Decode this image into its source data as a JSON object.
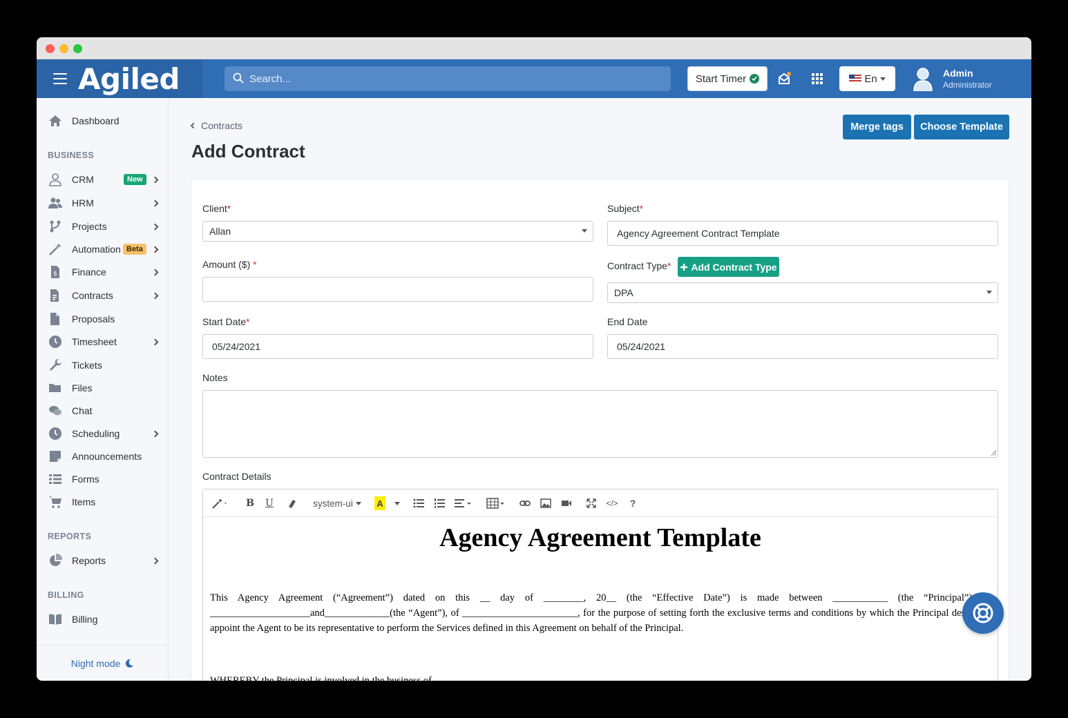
{
  "app": {
    "brand": "Agiled"
  },
  "search": {
    "placeholder": "Search..."
  },
  "topbar": {
    "start_timer_label": "Start Timer",
    "language": "En",
    "user_name": "Admin",
    "user_role": "Administrator"
  },
  "sidebar": {
    "dashboard": "Dashboard",
    "section_business": "BUSINESS",
    "items": [
      {
        "label": "CRM",
        "icon": "user-icon",
        "badge": "New"
      },
      {
        "label": "HRM",
        "icon": "users-icon"
      },
      {
        "label": "Projects",
        "icon": "projects-icon"
      },
      {
        "label": "Automation",
        "icon": "magic-wand-icon",
        "badge": "Beta"
      },
      {
        "label": "Finance",
        "icon": "finance-icon"
      },
      {
        "label": "Contracts",
        "icon": "contracts-icon"
      },
      {
        "label": "Proposals",
        "icon": "proposals-icon"
      },
      {
        "label": "Timesheet",
        "icon": "clock-icon"
      },
      {
        "label": "Tickets",
        "icon": "wrench-icon"
      },
      {
        "label": "Files",
        "icon": "folder-icon"
      },
      {
        "label": "Chat",
        "icon": "chat-icon"
      },
      {
        "label": "Scheduling",
        "icon": "clock-icon"
      },
      {
        "label": "Announcements",
        "icon": "note-icon"
      },
      {
        "label": "Forms",
        "icon": "list-icon"
      },
      {
        "label": "Items",
        "icon": "cart-icon"
      }
    ],
    "section_reports": "REPORTS",
    "reports": "Reports",
    "section_billing": "BILLING",
    "billing": "Billing",
    "night_mode": "Night mode"
  },
  "page": {
    "breadcrumb": "Contracts",
    "title": "Add Contract",
    "merge_tags": "Merge tags",
    "choose_template": "Choose Template"
  },
  "form": {
    "client_label": "Client",
    "client_value": "Allan",
    "subject_label": "Subject",
    "subject_value": "Agency Agreement Contract Template",
    "amount_label": "Amount ($)",
    "amount_value": "",
    "contract_type_label": "Contract Type",
    "add_contract_type": "Add Contract Type",
    "contract_type_value": "DPA",
    "start_date_label": "Start Date",
    "start_date_value": "05/24/2021",
    "end_date_label": "End Date",
    "end_date_value": "05/24/2021",
    "notes_label": "Notes",
    "details_label": "Contract Details",
    "required_mark": "*"
  },
  "editor": {
    "font": "system-ui",
    "help": "?",
    "code": "</>",
    "heading": "Agency Agreement Template",
    "paragraph1": "This Agency Agreement (“Agreement”) dated on this __ day of ________, 20__ (the “Effective Date”) is made between ___________ (the “Principal”) of ____________________and_____________(the “Agent”), of _______________________, for the purpose of setting forth the exclusive terms and conditions by which the Principal desires to appoint the Agent to be its representative to perform the Services defined in this Agreement on behalf of the Principal.",
    "paragraph2": "WHEREBY the Principal is involved in the business of ________________."
  },
  "colors": {
    "brand": "#2f6db5",
    "button": "#1b73b3",
    "success": "#17a086"
  }
}
